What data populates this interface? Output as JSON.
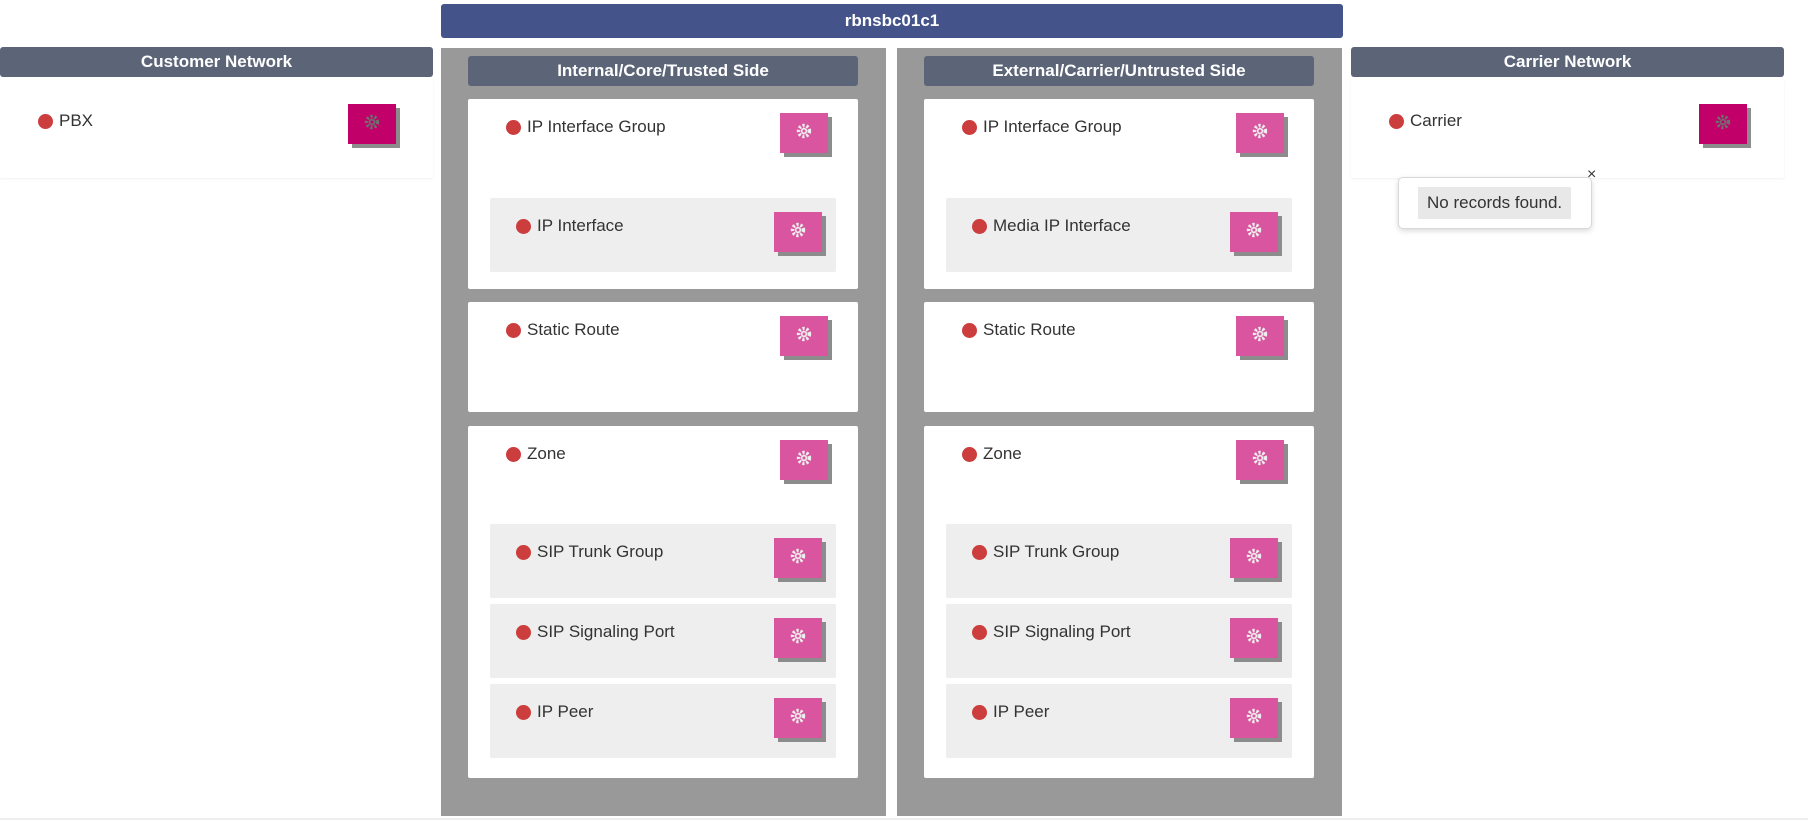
{
  "device": {
    "title": "rbnsbc01c1"
  },
  "customer": {
    "header": "Customer Network",
    "item": "PBX"
  },
  "carrier": {
    "header": "Carrier Network",
    "item": "Carrier",
    "popover": {
      "message": "No records found.",
      "close": "×"
    }
  },
  "internal": {
    "header": "Internal/Core/Trusted Side",
    "ip_interface_group": "IP Interface Group",
    "ip_interface": "IP Interface",
    "static_route": "Static Route",
    "zone": "Zone",
    "sip_trunk_group": "SIP Trunk Group",
    "sip_signaling_port": "SIP Signaling Port",
    "ip_peer": "IP Peer"
  },
  "external": {
    "header": "External/Carrier/Untrusted Side",
    "ip_interface_group": "IP Interface Group",
    "media_ip_interface": "Media IP Interface",
    "static_route": "Static Route",
    "zone": "Zone",
    "sip_trunk_group": "SIP Trunk Group",
    "sip_signaling_port": "SIP Signaling Port",
    "ip_peer": "IP Peer"
  },
  "icons": {
    "status": "status-dot-icon",
    "settings": "gear-icon"
  },
  "colors": {
    "title_bar": "#44548a",
    "header_bar": "#5c6578",
    "status_red": "#cc3d3d",
    "gear_pink": "#d9559f",
    "gear_magenta": "#c2006a",
    "column_gray": "#999999"
  }
}
